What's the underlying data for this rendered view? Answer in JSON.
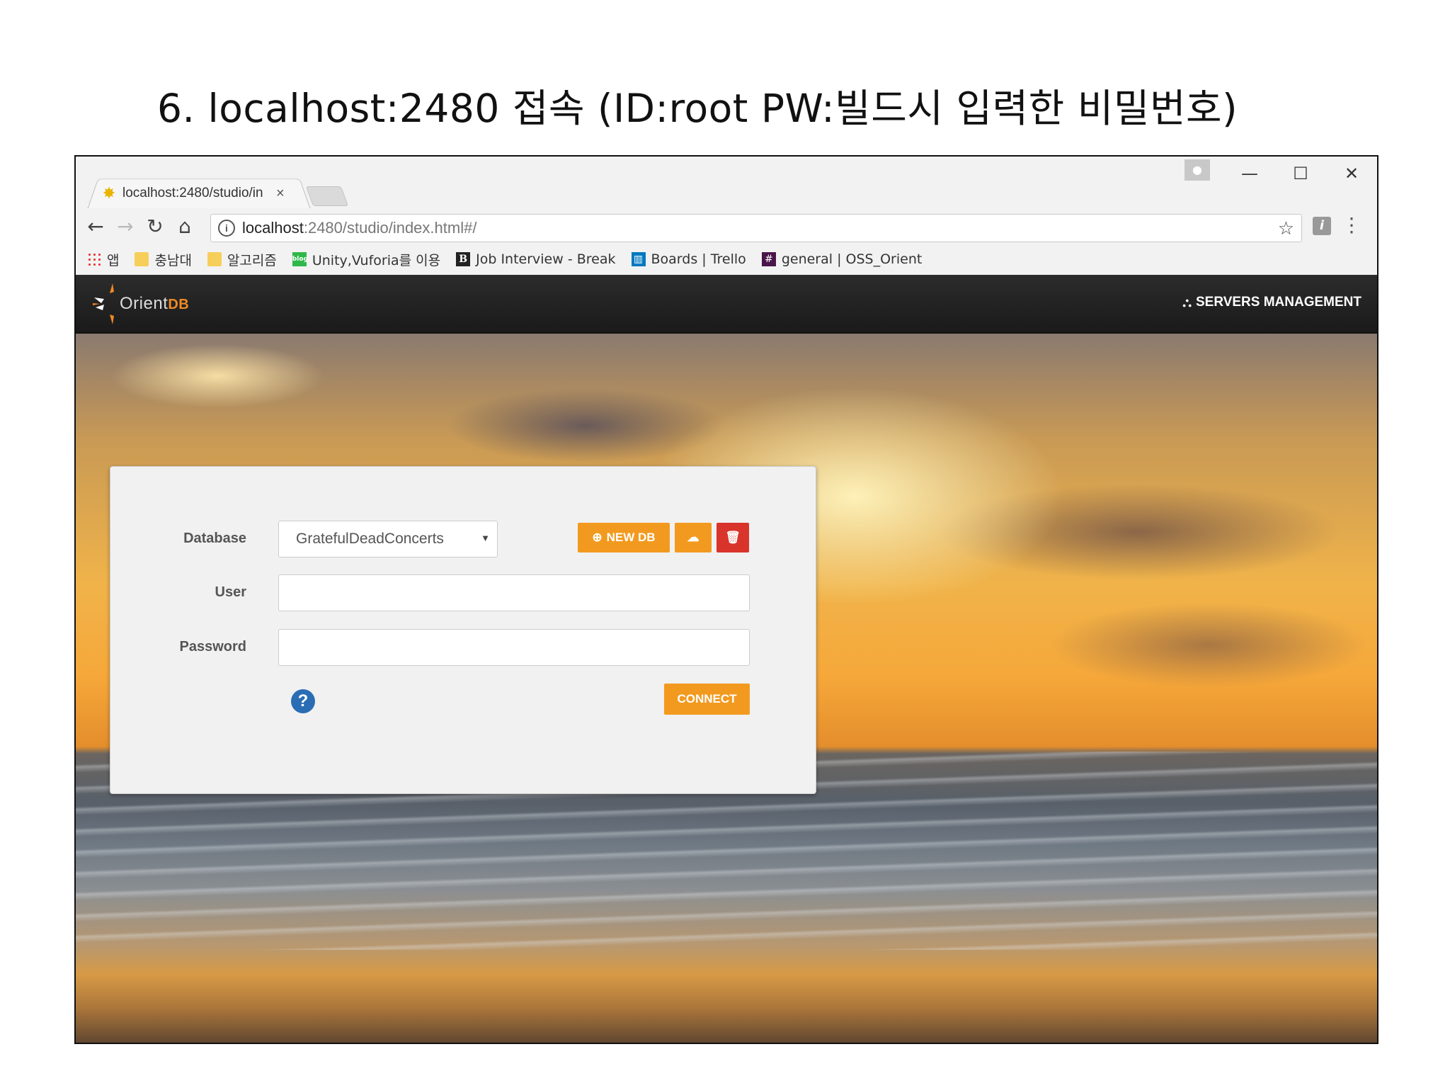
{
  "slide": {
    "title": "6. localhost:2480 접속 (ID:root PW:빌드시 입력한 비밀번호)"
  },
  "browser": {
    "tab": {
      "title": "localhost:2480/studio/in",
      "favicon": "sun-favicon-icon",
      "close": "×"
    },
    "window_controls": {
      "minimize": "—",
      "maximize": "☐",
      "close": "✕"
    },
    "address": {
      "host": "localhost",
      "path": ":2480/studio/index.html#/"
    },
    "bookmarks": [
      {
        "label": "앱",
        "icon": "apps-grid-icon"
      },
      {
        "label": "충남대",
        "icon": "folder-icon"
      },
      {
        "label": "알고리즘",
        "icon": "folder-icon"
      },
      {
        "label": "Unity,Vuforia를 이용",
        "icon": "blog-icon"
      },
      {
        "label": "Job Interview - Break",
        "icon": "b-logo-icon"
      },
      {
        "label": "Boards | Trello",
        "icon": "trello-icon"
      },
      {
        "label": "general | OSS_Orient",
        "icon": "slack-hash-icon"
      }
    ]
  },
  "app": {
    "logo": {
      "text": "Orient",
      "accent": "DB"
    },
    "servers_management": "SERVERS MANAGEMENT",
    "login": {
      "database_label": "Database",
      "database_value": "GratefulDeadConcerts",
      "user_label": "User",
      "user_value": "",
      "password_label": "Password",
      "password_value": "",
      "new_db_label": "NEW DB",
      "connect_label": "CONNECT"
    }
  },
  "colors": {
    "accent": "#f29a1f",
    "danger": "#d9342b",
    "help": "#2a6db5"
  }
}
